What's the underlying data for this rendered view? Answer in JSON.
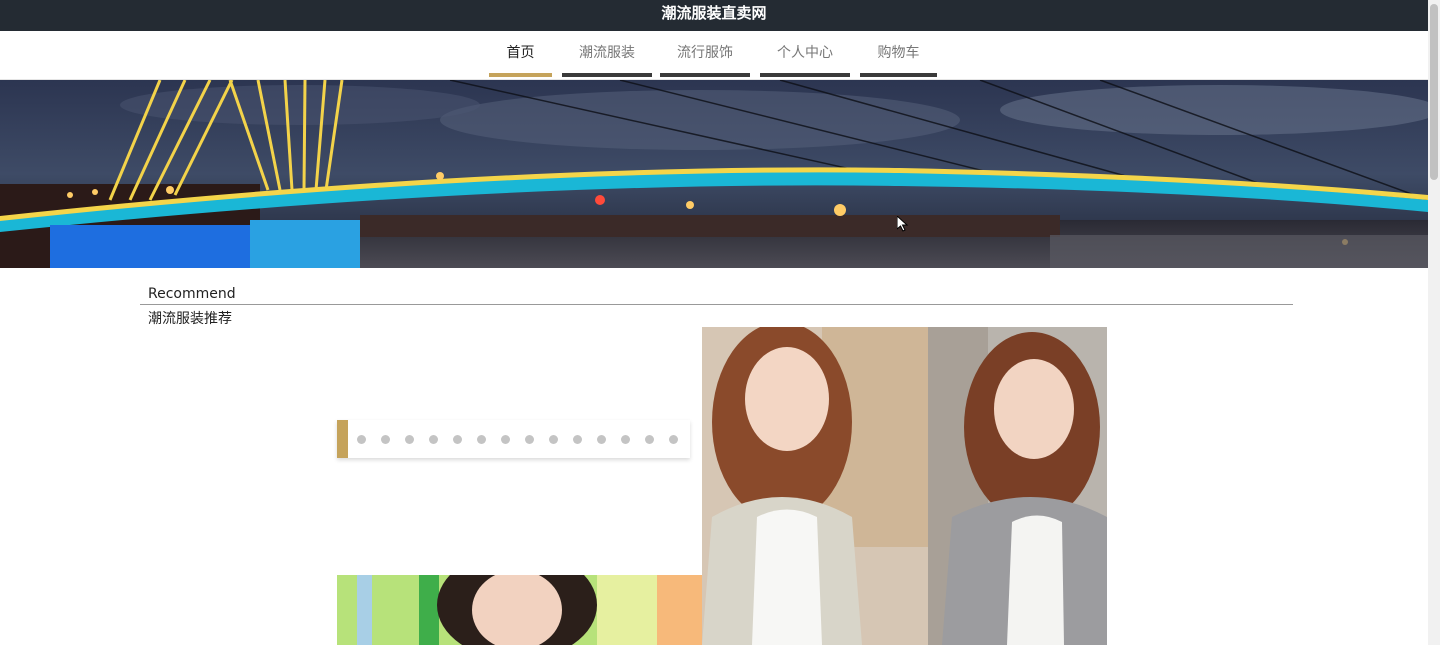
{
  "header": {
    "site_title": "潮流服装直卖网"
  },
  "nav": {
    "items": [
      {
        "label": "首页",
        "active": true
      },
      {
        "label": "潮流服装",
        "active": false
      },
      {
        "label": "流行服饰",
        "active": false
      },
      {
        "label": "个人中心",
        "active": false
      },
      {
        "label": "购物车",
        "active": false
      }
    ]
  },
  "section": {
    "title_en": "Recommend",
    "title_cn": "潮流服装推荐"
  },
  "carousel": {
    "dot_count": 14
  },
  "colors": {
    "accent": "#c5a35b",
    "topbar": "#242b33"
  }
}
